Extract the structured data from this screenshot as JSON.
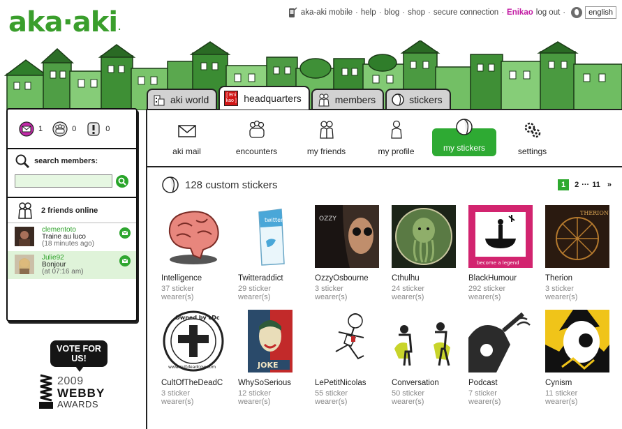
{
  "logo": {
    "text": "aka·aki",
    "dot": "."
  },
  "topnav": {
    "links": [
      "aka-aki mobile",
      "help",
      "blog",
      "shop",
      "secure connection"
    ],
    "user": "Enikao",
    "logout": "log out",
    "separator": "·",
    "language": "english"
  },
  "tabs": [
    {
      "label": "aki world",
      "icon": "world-icon"
    },
    {
      "label": "headquarters",
      "icon": "headquarters-icon",
      "icon_text": "[ Eni kao ]"
    },
    {
      "label": "members",
      "icon": "members-icon"
    },
    {
      "label": "stickers",
      "icon": "sticker-icon"
    }
  ],
  "active_tab": "headquarters",
  "subnav": [
    {
      "label": "aki mail",
      "icon": "envelope-icon"
    },
    {
      "label": "encounters",
      "icon": "encounters-icon"
    },
    {
      "label": "my friends",
      "icon": "friends-icon"
    },
    {
      "label": "my profile",
      "icon": "profile-icon"
    },
    {
      "label": "my stickers",
      "icon": "sticker-icon"
    },
    {
      "label": "settings",
      "icon": "gears-icon"
    }
  ],
  "active_subnav": "my stickers",
  "left_panel": {
    "counters": [
      {
        "icon": "mail-icon",
        "value": "1"
      },
      {
        "icon": "encounters-icon",
        "value": "0"
      },
      {
        "icon": "alert-icon",
        "value": "0"
      }
    ],
    "search": {
      "label": "search members:",
      "value": ""
    },
    "friends_online": {
      "title": "2 friends online",
      "items": [
        {
          "name": "clementoto",
          "status": "Traine au luco",
          "time": "(18 minutes ago)"
        },
        {
          "name": "Julie92",
          "status": "Bonjour",
          "time": "(at 07:16 am)"
        }
      ]
    }
  },
  "webby": {
    "vote": "VOTE FOR US!",
    "year": "2009",
    "name": "WEBBY",
    "awards": "AWARDS"
  },
  "stickers": {
    "heading": "128 custom stickers",
    "pager": {
      "current": "1",
      "next": "2",
      "ellipsis": "···",
      "last": "11",
      "forward": "»"
    },
    "items": [
      {
        "title": "Intelligence",
        "count": "37 sticker",
        "unit": "wearer(s)"
      },
      {
        "title": "Twitteraddict",
        "count": "29 sticker",
        "unit": "wearer(s)"
      },
      {
        "title": "OzzyOsbourne",
        "count": "3 sticker",
        "unit": "wearer(s)"
      },
      {
        "title": "Cthulhu",
        "count": "24 sticker",
        "unit": "wearer(s)"
      },
      {
        "title": "BlackHumour",
        "count": "292 sticker",
        "unit": "wearer(s)"
      },
      {
        "title": "Therion",
        "count": "3 sticker",
        "unit": "wearer(s)"
      },
      {
        "title": "CultOfTheDeadC",
        "count": "3 sticker",
        "unit": "wearer(s)"
      },
      {
        "title": "WhySoSerious",
        "count": "12 sticker",
        "unit": "wearer(s)"
      },
      {
        "title": "LePetitNicolas",
        "count": "55 sticker",
        "unit": "wearer(s)"
      },
      {
        "title": "Conversation",
        "count": "50 sticker",
        "unit": "wearer(s)"
      },
      {
        "title": "Podcast",
        "count": "7 sticker",
        "unit": "wearer(s)"
      },
      {
        "title": "Cynism",
        "count": "11 sticker",
        "unit": "wearer(s)"
      }
    ],
    "thumb_texts": {
      "twitter": "twitter",
      "ozzy": "OZZY",
      "blackhumour": "become a legend",
      "therion": "THERION",
      "cdc": "Øwned by cDc",
      "cdc_url": "www.cultdeadcow.com",
      "joke": "JOKE"
    }
  },
  "colors": {
    "brand_green": "#3a9e2c",
    "active_green": "#2eaa33",
    "user_pink": "#c21aa3"
  }
}
